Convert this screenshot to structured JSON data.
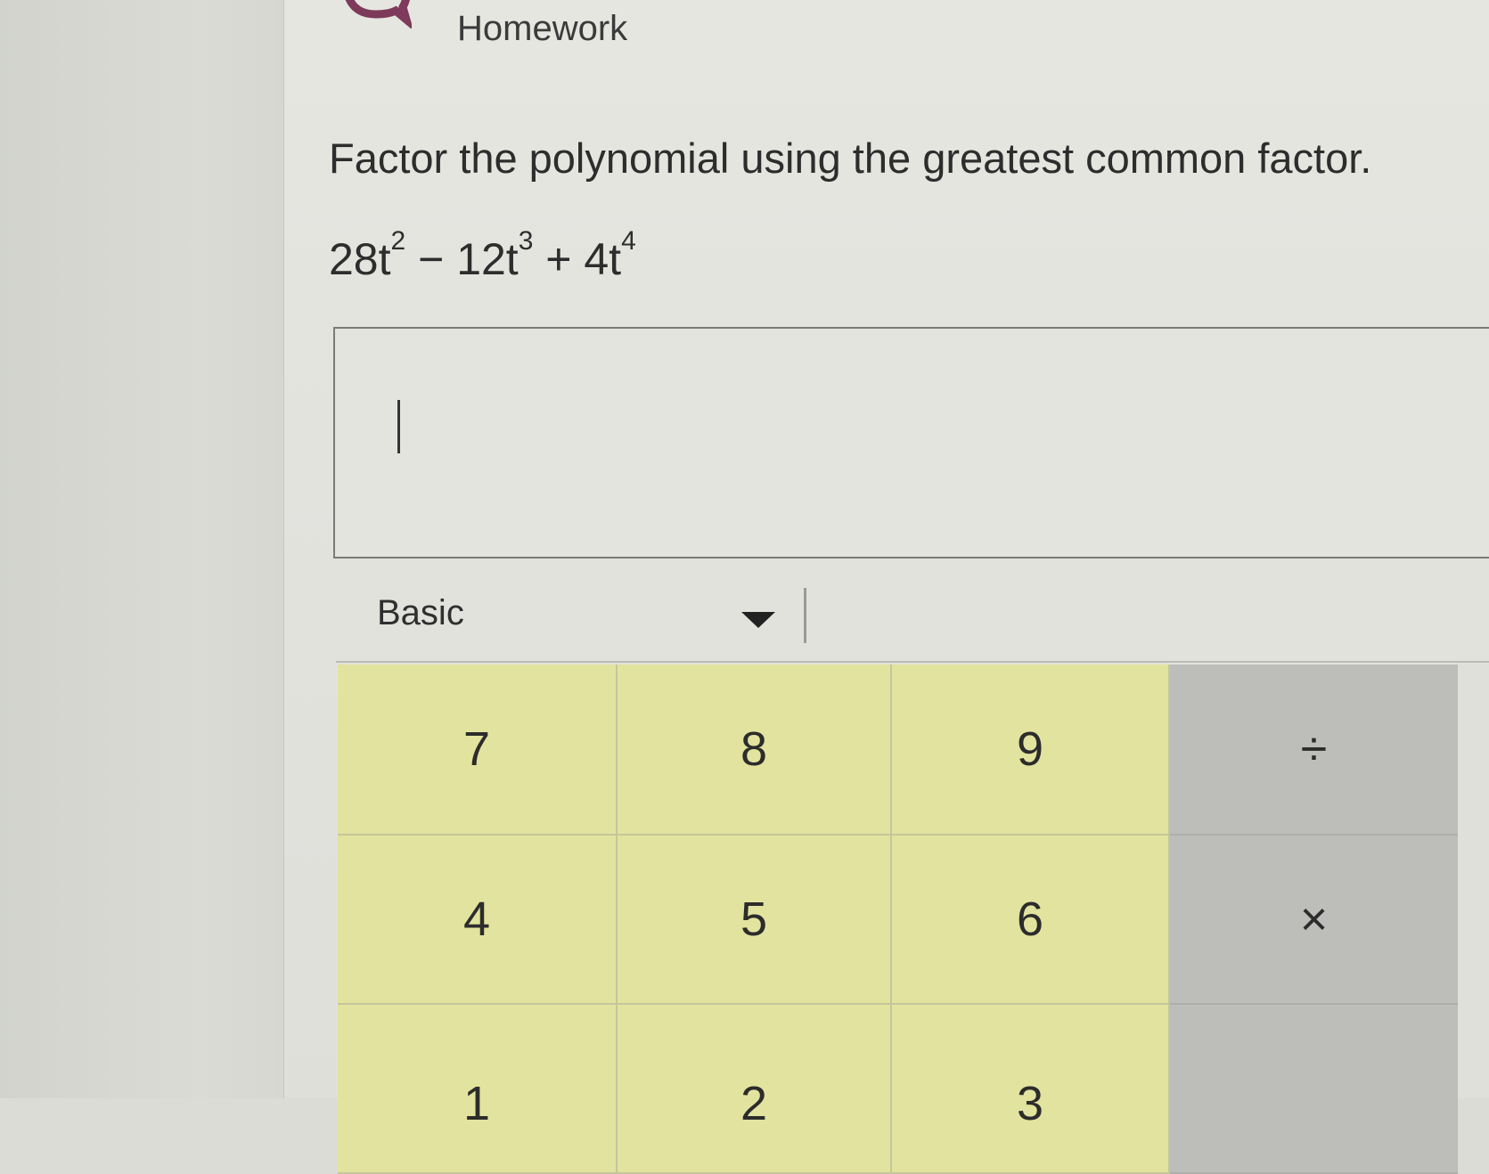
{
  "header": {
    "title": "Homework"
  },
  "problem": {
    "instruction": "Factor the polynomial using the greatest common factor.",
    "expression": {
      "term1": "28t",
      "exp1": "2",
      "op1": " − ",
      "term2": "12t",
      "exp2": "3",
      "op2": " + ",
      "term3": "4t",
      "exp3": "4"
    }
  },
  "answer": {
    "value": ""
  },
  "keypad": {
    "mode": "Basic",
    "keys": {
      "k7": "7",
      "k8": "8",
      "k9": "9",
      "divide": "÷",
      "k4": "4",
      "k5": "5",
      "k6": "6",
      "times": "×",
      "k1": "1",
      "k2": "2",
      "k3": "3"
    }
  },
  "colors": {
    "number_key": "#e2e39e",
    "operator_key": "#bdbdba",
    "brand_icon": "#7d3a5a"
  }
}
